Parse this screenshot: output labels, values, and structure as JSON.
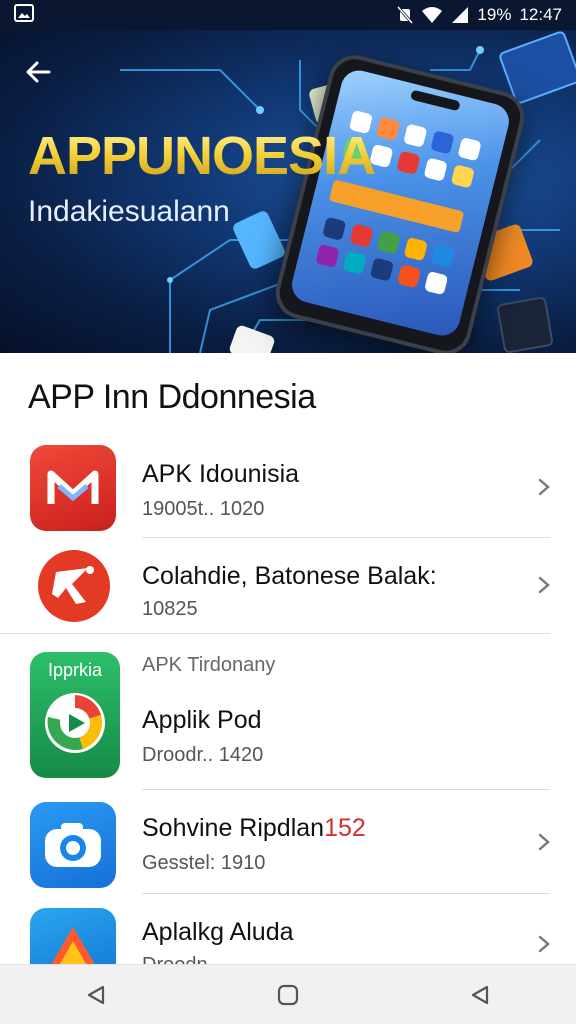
{
  "status_bar": {
    "battery": "19%",
    "time": "12:47",
    "icons": [
      "image-notification-icon",
      "mute-icon",
      "wifi-icon",
      "signal-icon"
    ]
  },
  "banner": {
    "title": "APPUNOESIA",
    "subtitle": "Indakiesualann"
  },
  "section": {
    "title": "APP Inn Ddonnesia"
  },
  "apps": [
    {
      "name": "APK Idounisia",
      "meta": "19005t.. 1020",
      "icon": "red-m-app-icon",
      "color": "#e4312b"
    },
    {
      "name": "Colahdie, Batonese Balak:",
      "meta": "10825",
      "icon": "red-runner-app-icon",
      "color": "#e23a25"
    },
    {
      "category": "APK Tirdonany",
      "name": "Applik Pod",
      "meta": "Droodr.. 1420",
      "icon": "green-play-app-icon",
      "icon_label": "Ipprkia",
      "color": "#1fa05a"
    },
    {
      "name": "Sohvine Ripdlan",
      "name_highlight": "152",
      "meta": "Gesstel: 1910",
      "icon": "blue-camera-app-icon",
      "color": "#1b86e8"
    },
    {
      "name": "Aplalkg Aluda",
      "meta": "Droodn",
      "icon": "blue-triangle-app-icon",
      "color": "#1a8fe0"
    }
  ],
  "colors": {
    "status_bar": "#0b1630",
    "banner_accent": "#f5d33a",
    "divider": "#dcdcdc",
    "highlight": "#d13030"
  }
}
